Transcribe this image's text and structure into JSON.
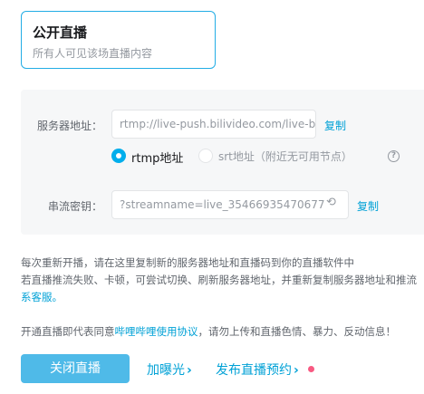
{
  "mode_card": {
    "title": "公开直播",
    "description": "所有人可见该场直播内容"
  },
  "server": {
    "label": "服务器地址：",
    "value": "rtmp://live-push.bilivideo.com/live-bv",
    "copy_label": "复制"
  },
  "protocol": {
    "options": [
      {
        "label": "rtmp地址",
        "selected": true
      },
      {
        "label": "srt地址（附近无可用节点）",
        "selected": false
      }
    ],
    "help_glyph": "?"
  },
  "stream_key": {
    "label": "串流密钥：",
    "value": "?streamname=live_35466935470677",
    "copy_label": "复制",
    "refresh_glyph": "⟲"
  },
  "info": {
    "line1": "每次重新开播，请在这里复制新的服务器地址和直播码到你的直播软件中",
    "line2": "若直播推流失败、卡顿，可尝试切换、刷新服务器地址，并重新复制服务器地址和推流",
    "line3": "系客服。",
    "agreement_prefix": "开通直播即代表同意",
    "agreement_link": "哔哩哔哩使用协议",
    "agreement_suffix": "，请勿上传和直播色情、暴力、反动信息！"
  },
  "actions": {
    "close_label": "关闭直播",
    "boost_label": "加曝光",
    "schedule_label": "发布直播预约",
    "chevron": "›"
  },
  "colors": {
    "accent": "#00a1d6",
    "primary_button": "#4fbae8",
    "card_border": "#23ade5",
    "notification_dot": "#f85a82"
  },
  "icons": {
    "help": "question-circle-icon",
    "refresh": "refresh-icon",
    "chevron": "chevron-right-icon"
  }
}
